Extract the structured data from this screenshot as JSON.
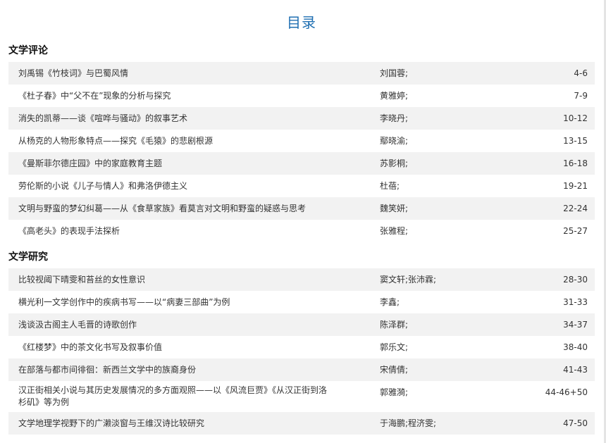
{
  "page_title": "目录",
  "sections": [
    {
      "heading": "文学评论",
      "articles": [
        {
          "title": "刘禹锡《竹枝词》与巴蜀风情",
          "author": "刘国蓉;",
          "pages": "4-6"
        },
        {
          "title": "《杜子春》中“父不在”现象的分析与探究",
          "author": "黄雅婷;",
          "pages": "7-9"
        },
        {
          "title": "消失的凯蒂——谈《喧哗与骚动》的叙事艺术",
          "author": "李晓丹;",
          "pages": "10-12"
        },
        {
          "title": "从杨克的人物形象特点——探究《毛猿》的悲剧根源",
          "author": "鄢晓渝;",
          "pages": "13-15"
        },
        {
          "title": "《曼斯菲尔德庄园》中的家庭教育主题",
          "author": "苏影桐;",
          "pages": "16-18"
        },
        {
          "title": "劳伦斯的小说《儿子与情人》和弗洛伊德主义",
          "author": "杜蓓;",
          "pages": "19-21"
        },
        {
          "title": "文明与野蛮的梦幻纠葛——从《食草家族》看莫言对文明和野蛮的疑惑与思考",
          "author": "魏笑妍;",
          "pages": "22-24"
        },
        {
          "title": "《高老头》的表现手法探析",
          "author": "张雅程;",
          "pages": "25-27"
        }
      ]
    },
    {
      "heading": "文学研究",
      "articles": [
        {
          "title": "比较视阈下晴雯和苔丝的女性意识",
          "author": "窦文轩;张沛霖;",
          "pages": "28-30"
        },
        {
          "title": "横光利一文学创作中的疾病书写——以“病妻三部曲”为例",
          "author": "李鑫;",
          "pages": "31-33"
        },
        {
          "title": "浅谈汲古阁主人毛晋的诗歌创作",
          "author": "陈泽群;",
          "pages": "34-37"
        },
        {
          "title": "《红楼梦》中的茶文化书写及叙事价值",
          "author": "郭乐文;",
          "pages": "38-40"
        },
        {
          "title": "在部落与都市间徘徊：新西兰文学中的族裔身份",
          "author": "宋倩倩;",
          "pages": "41-43"
        },
        {
          "title": "汉正街相关小说与其历史发展情况的多方面观照——以《风流巨贾》《从汉正街到洛杉矶》等为例",
          "author": "郭雅漪;",
          "pages": "44-46+50"
        },
        {
          "title": "文学地理学视野下的广濑淡窗与王维汉诗比较研究",
          "author": "于海鹏;程济雯;",
          "pages": "47-50"
        }
      ]
    }
  ]
}
